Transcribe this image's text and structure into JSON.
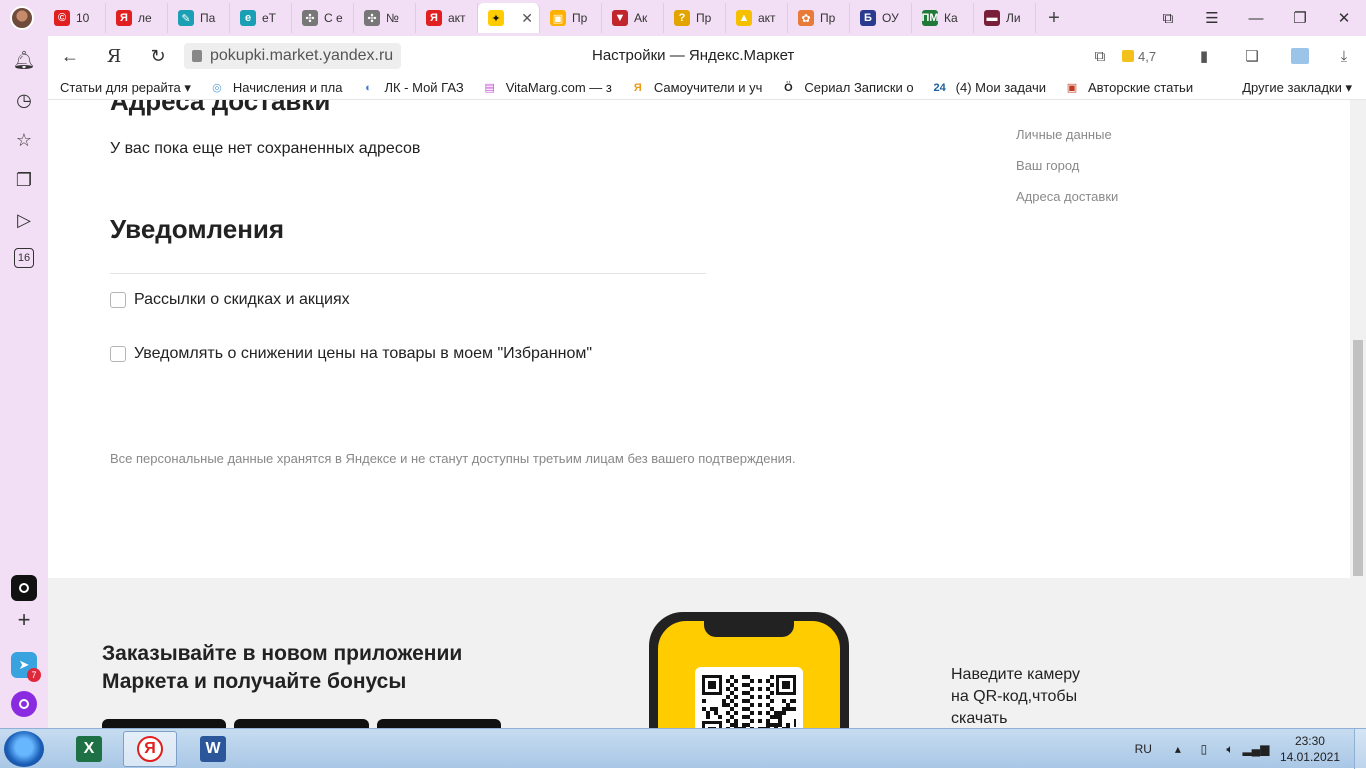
{
  "browser": {
    "tabs": [
      {
        "label": "10",
        "icon": "copyright-icon",
        "color": "#e02020"
      },
      {
        "label": "ле",
        "icon": "yandex-icon",
        "color": "#e02020"
      },
      {
        "label": "Па",
        "icon": "edit-icon",
        "color": "#1a9fb5"
      },
      {
        "label": "eT",
        "icon": "etxt-icon",
        "color": "#1a9fb5"
      },
      {
        "label": "С е",
        "icon": "ornament-icon",
        "color": "#777777"
      },
      {
        "label": "№",
        "icon": "ornament-icon",
        "color": "#777777"
      },
      {
        "label": "акт",
        "icon": "yandex-icon",
        "color": "#e02020"
      },
      {
        "label": "",
        "icon": "yandex-market-icon",
        "color": "#ffcc00"
      },
      {
        "label": "Пр",
        "icon": "box-icon",
        "color": "#ffb100"
      },
      {
        "label": "Ак",
        "icon": "shield-icon",
        "color": "#c0262c"
      },
      {
        "label": "Пр",
        "icon": "question-icon",
        "color": "#e2a400"
      },
      {
        "label": "акт",
        "icon": "image-icon",
        "color": "#f5c000"
      },
      {
        "label": "Пр",
        "icon": "gift-icon",
        "color": "#e87a3a"
      },
      {
        "label": "ОУ",
        "icon": "b-icon",
        "color": "#2a3b8f"
      },
      {
        "label": "Ка",
        "icon": "pm-icon",
        "color": "#1f7a3a"
      },
      {
        "label": "Ли",
        "icon": "book-icon",
        "color": "#7a1f3a"
      }
    ],
    "url": "pokupki.market.yandex.ru",
    "page_title": "Настройки — Яндекс.Маркет",
    "rating": "4,7",
    "bookmarks": [
      {
        "label": "Статьи для рерайта ▾"
      },
      {
        "label": "Начисления и пла",
        "icon": "globe-icon"
      },
      {
        "label": "ЛК - Мой ГАЗ",
        "icon": "gas-icon"
      },
      {
        "label": "VitaMarg.com — з",
        "icon": "rainbow-icon"
      },
      {
        "label": "Самоучители и уч",
        "icon": "yandex-icon"
      },
      {
        "label": "Сериал Записки о",
        "icon": "o-icon"
      },
      {
        "label": "(4) Мои задачи",
        "icon": "24-icon"
      },
      {
        "label": "Авторские статьи",
        "icon": "square-icon"
      }
    ],
    "other_bookmarks": "Другие закладки ▾"
  },
  "sidebar": {
    "badge_count": "7",
    "calendar_day": "16"
  },
  "page": {
    "address_heading": "Адреса доставки",
    "no_addresses": "У вас пока еще нет сохраненных адресов",
    "notifications_heading": "Уведомления",
    "options": [
      {
        "label": "Рассылки о скидках и акциях",
        "checked": false
      },
      {
        "label": "Уведомлять о снижении цены на товары в моем \"Избранном\"",
        "checked": false
      }
    ],
    "privacy_note": "Все персональные данные хранятся в Яндексе и не станут доступны третьим лицам без вашего подтверждения.",
    "right_nav": [
      "Личные данные",
      "Ваш город",
      "Адреса доставки"
    ],
    "promo_title": "Заказывайте в новом приложении Маркета и получайте бонусы",
    "qr_hint": "Наведите камеру на QR-код,чтобы скачать"
  },
  "taskbar": {
    "language": "RU",
    "time": "23:30",
    "date": "14.01.2021"
  },
  "colors": {
    "chrome_bg": "#f3dff5",
    "market_yellow": "#ffcc00",
    "footer_bg": "#f1f1f1",
    "muted_text": "#888888"
  }
}
